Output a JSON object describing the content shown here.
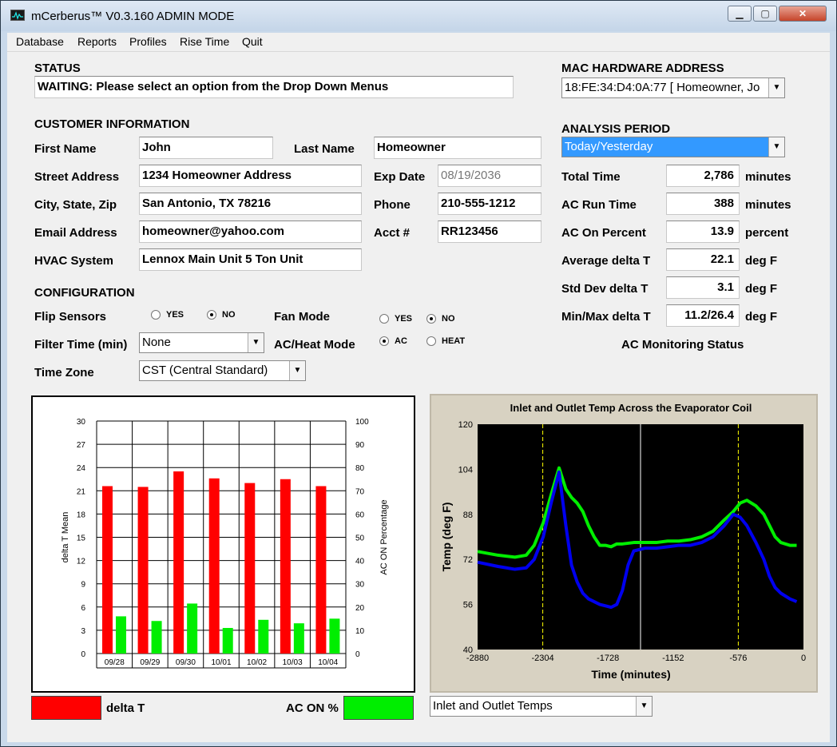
{
  "window": {
    "title": "mCerberus™ V0.3.160 ADMIN MODE"
  },
  "menu": [
    "Database",
    "Reports",
    "Profiles",
    "Rise Time",
    "Quit"
  ],
  "status": {
    "label": "STATUS",
    "text": "WAITING: Please select an option from the Drop Down Menus"
  },
  "mac": {
    "label": "MAC HARDWARE ADDRESS",
    "value": "18:FE:34:D4:0A:77 [ Homeowner, Jo"
  },
  "customer": {
    "header": "CUSTOMER INFORMATION",
    "first_name_label": "First Name",
    "first_name": "John",
    "last_name_label": "Last Name",
    "last_name": "Homeowner",
    "street_label": "Street Address",
    "street": "1234 Homeowner Address",
    "exp_label": "Exp Date",
    "exp": "08/19/2036",
    "city_label": "City, State, Zip",
    "city": "San Antonio, TX  78216",
    "phone_label": "Phone",
    "phone": "210-555-1212",
    "email_label": "Email Address",
    "email": "homeowner@yahoo.com",
    "acct_label": "Acct #",
    "acct": "RR123456",
    "hvac_label": "HVAC System",
    "hvac": "Lennox Main Unit 5 Ton Unit"
  },
  "config": {
    "header": "CONFIGURATION",
    "flip_label": "Flip Sensors",
    "flip_yes": "YES",
    "flip_no": "NO",
    "fan_label": "Fan Mode",
    "fan_yes": "YES",
    "fan_no": "NO",
    "filter_label": "Filter Time (min)",
    "filter_value": "None",
    "mode_label": "AC/Heat Mode",
    "mode_ac": "AC",
    "mode_heat": "HEAT",
    "tz_label": "Time Zone",
    "tz_value": "CST (Central Standard)"
  },
  "analysis": {
    "header": "ANALYSIS PERIOD",
    "period": "Today/Yesterday",
    "total_label": "Total Time",
    "total": "2,786",
    "total_unit": "minutes",
    "run_label": "AC Run Time",
    "run": "388",
    "run_unit": "minutes",
    "pct_label": "AC On Percent",
    "pct": "13.9",
    "pct_unit": "percent",
    "avg_label": "Average delta T",
    "avg": "22.1",
    "avg_unit": "deg F",
    "std_label": "Std Dev delta T",
    "std": "3.1",
    "std_unit": "deg F",
    "minmax_label": "Min/Max delta T",
    "minmax": "11.2/26.4",
    "minmax_unit": "deg F",
    "monitor_label": "AC Monitoring Status",
    "monitor_color": "#10ee20"
  },
  "legend": {
    "delta_label": "delta T",
    "ac_label": "AC ON %",
    "red": "#ff0000",
    "green": "#00ee00"
  },
  "chart_select": "Inlet and Outlet Temps",
  "chart_data": [
    {
      "type": "bar",
      "categories": [
        "09/28",
        "09/29",
        "09/30",
        "10/01",
        "10/02",
        "10/03",
        "10/04"
      ],
      "series": [
        {
          "name": "delta T",
          "axis": "left",
          "color": "#ff0000",
          "values": [
            21.6,
            21.5,
            23.5,
            22.6,
            22.0,
            22.5,
            21.6
          ]
        },
        {
          "name": "AC ON %",
          "axis": "right",
          "color": "#00ee00",
          "values": [
            16,
            14,
            21.5,
            11,
            14.5,
            13,
            15
          ]
        }
      ],
      "ylabel": "delta T Mean",
      "ylim": [
        0,
        30
      ],
      "yticks": [
        0,
        3,
        6,
        9,
        12,
        15,
        18,
        21,
        24,
        27,
        30
      ],
      "y2label": "AC ON Percentage",
      "y2lim": [
        0,
        100
      ],
      "y2ticks": [
        0,
        10,
        20,
        30,
        40,
        50,
        60,
        70,
        80,
        90,
        100
      ],
      "grid": true
    },
    {
      "type": "scatter",
      "title": "Inlet and Outlet Temp Across the Evaporator Coil",
      "xlabel": "Time (minutes)",
      "ylabel": "Temp (deg F)",
      "xlim": [
        -2880,
        0
      ],
      "ylim": [
        40,
        120
      ],
      "xticks": [
        -2880,
        -2304,
        -1728,
        -1152,
        -576,
        0
      ],
      "yticks": [
        40,
        56,
        72,
        88,
        104,
        120
      ],
      "vlines": [
        {
          "x": -2304,
          "color": "#ffff00",
          "style": "dashed"
        },
        {
          "x": -1440,
          "color": "#ffffff",
          "style": "solid"
        },
        {
          "x": -576,
          "color": "#ffff00",
          "style": "dashed"
        }
      ],
      "series": [
        {
          "name": "Inlet",
          "color": "#00ee00",
          "points": [
            [
              -2880,
              74.8
            ],
            [
              -2700,
              73.5
            ],
            [
              -2550,
              72.8
            ],
            [
              -2450,
              73.5
            ],
            [
              -2380,
              77
            ],
            [
              -2300,
              85
            ],
            [
              -2230,
              95
            ],
            [
              -2160,
              104.5
            ],
            [
              -2100,
              97
            ],
            [
              -2050,
              94
            ],
            [
              -2000,
              92
            ],
            [
              -1950,
              89
            ],
            [
              -1900,
              84
            ],
            [
              -1850,
              80
            ],
            [
              -1800,
              77
            ],
            [
              -1750,
              77
            ],
            [
              -1700,
              76.5
            ],
            [
              -1650,
              77.5
            ],
            [
              -1600,
              77.5
            ],
            [
              -1500,
              78
            ],
            [
              -1400,
              78
            ],
            [
              -1300,
              78
            ],
            [
              -1200,
              78.5
            ],
            [
              -1100,
              78.5
            ],
            [
              -1000,
              79
            ],
            [
              -900,
              80
            ],
            [
              -800,
              82
            ],
            [
              -700,
              86
            ],
            [
              -620,
              89
            ],
            [
              -560,
              92
            ],
            [
              -500,
              93
            ],
            [
              -420,
              91
            ],
            [
              -350,
              88
            ],
            [
              -300,
              84
            ],
            [
              -250,
              80
            ],
            [
              -200,
              78
            ],
            [
              -120,
              77
            ],
            [
              -60,
              77
            ]
          ]
        },
        {
          "name": "Outlet",
          "color": "#0000ee",
          "points": [
            [
              -2880,
              71
            ],
            [
              -2700,
              69.5
            ],
            [
              -2550,
              68.5
            ],
            [
              -2450,
              69
            ],
            [
              -2380,
              72
            ],
            [
              -2300,
              80
            ],
            [
              -2230,
              92
            ],
            [
              -2160,
              103
            ],
            [
              -2100,
              84
            ],
            [
              -2050,
              70
            ],
            [
              -2000,
              64
            ],
            [
              -1950,
              60
            ],
            [
              -1900,
              58
            ],
            [
              -1850,
              57
            ],
            [
              -1800,
              56
            ],
            [
              -1750,
              55.5
            ],
            [
              -1700,
              55
            ],
            [
              -1650,
              56
            ],
            [
              -1600,
              61
            ],
            [
              -1550,
              70
            ],
            [
              -1500,
              75
            ],
            [
              -1400,
              76
            ],
            [
              -1300,
              76
            ],
            [
              -1200,
              76.5
            ],
            [
              -1100,
              77
            ],
            [
              -1000,
              77
            ],
            [
              -900,
              78
            ],
            [
              -800,
              80
            ],
            [
              -700,
              84
            ],
            [
              -620,
              88
            ],
            [
              -560,
              87
            ],
            [
              -500,
              84
            ],
            [
              -420,
              78
            ],
            [
              -350,
              72
            ],
            [
              -300,
              66
            ],
            [
              -250,
              62
            ],
            [
              -200,
              60
            ],
            [
              -120,
              58
            ],
            [
              -60,
              57
            ]
          ]
        }
      ]
    }
  ]
}
